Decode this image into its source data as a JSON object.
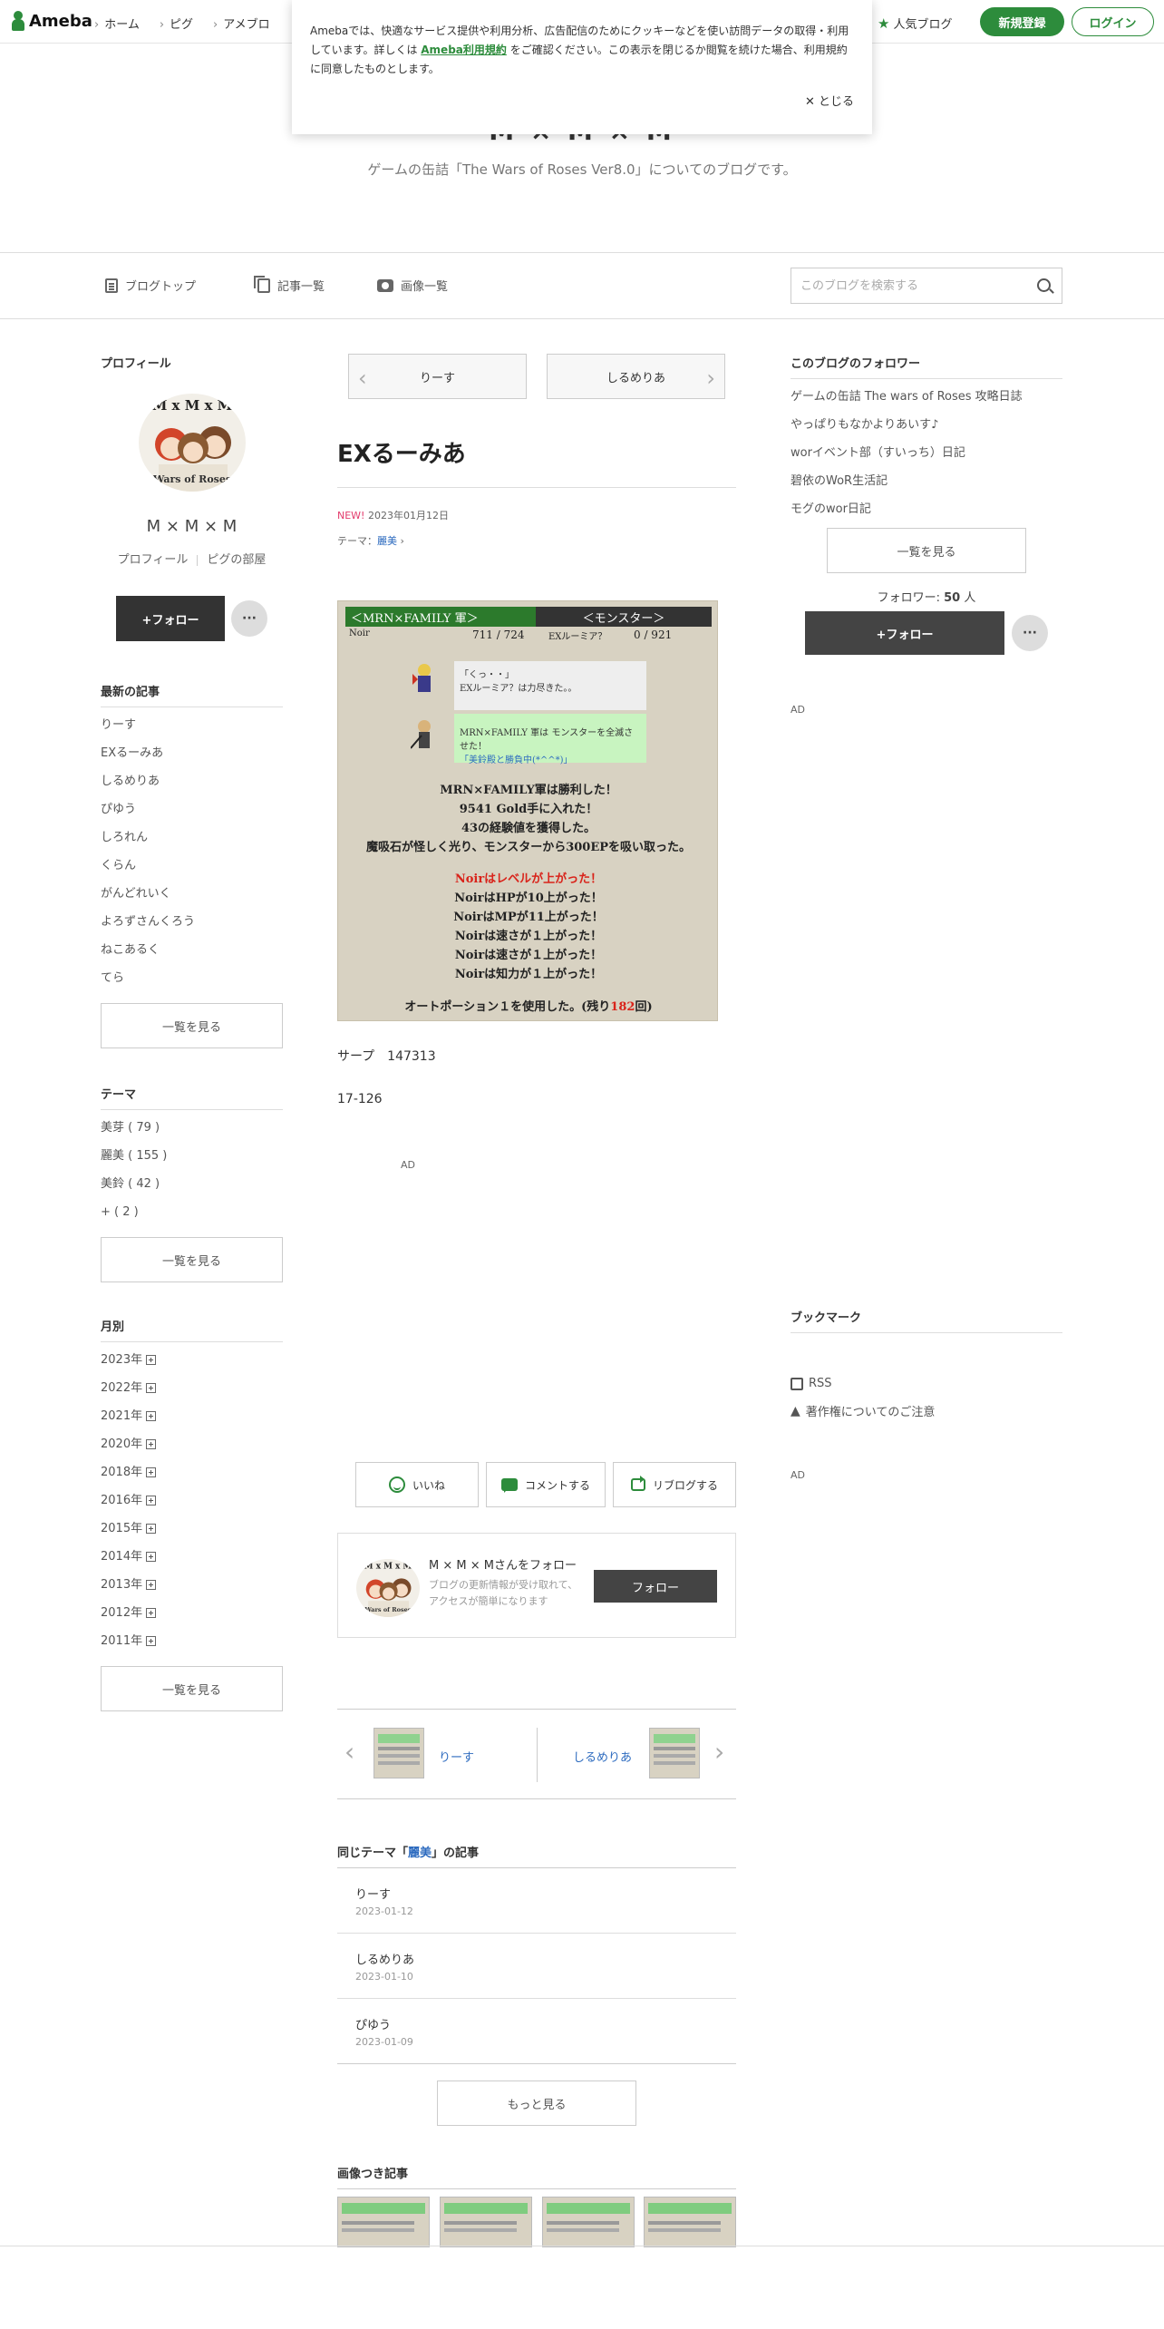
{
  "header": {
    "logo": "Ameba",
    "nav": [
      "ホーム",
      "ピグ",
      "アメブロ"
    ],
    "popular": "人気ブログ",
    "register": "新規登録",
    "login": "ログイン"
  },
  "cookie": {
    "text1": "Amebaでは、快適なサービス提供や利用分析、広告配信のためにクッキーなどを使い訪問データの取得・利用しています。詳しくは ",
    "link": "Ameba利用規約",
    "text2": " をご確認ください。この表示を閉じるか閲覧を続けた場合、利用規約に同意したものとします。",
    "close": "✕ とじる"
  },
  "blog": {
    "title": "M × M × M",
    "description": "ゲームの缶詰「The Wars of Roses Ver8.0」についてのブログです。"
  },
  "blognav": {
    "top": "ブログトップ",
    "list": "記事一覧",
    "images": "画像一覧",
    "search_placeholder": "このブログを検索する"
  },
  "profile": {
    "heading": "プロフィール",
    "avatar_text": "M x M x M",
    "avatar_sub": "Wars of Roses",
    "name": "M × M × M",
    "link_profile": "プロフィール",
    "link_room": "ピグの部屋",
    "follow": "+フォロー",
    "more": "···"
  },
  "recent": {
    "heading": "最新の記事",
    "items": [
      "りーす",
      "EXるーみあ",
      "しるめりあ",
      "ぴゆう",
      "しろれん",
      "くらん",
      "がんどれいく",
      "よろずさんくろう",
      "ねこあるく",
      "てら"
    ],
    "more": "一覧を見る"
  },
  "themes": {
    "heading": "テーマ",
    "items": [
      "美芽 ( 79 )",
      "麗美 ( 155 )",
      "美鈴 ( 42 )",
      "+ ( 2 )"
    ],
    "more": "一覧を見る"
  },
  "monthly": {
    "heading": "月別",
    "items": [
      "2023年",
      "2022年",
      "2021年",
      "2020年",
      "2018年",
      "2016年",
      "2015年",
      "2014年",
      "2013年",
      "2012年",
      "2011年"
    ],
    "more": "一覧を見る"
  },
  "entry": {
    "prev": "りーす",
    "next": "しるめりあ",
    "title": "EXるーみあ",
    "new": "NEW!",
    "date": "2023年01月12日",
    "theme_label": "テーマ：",
    "theme": "麗美",
    "body1": "サープ　147313",
    "body2": "17-126",
    "ad": "AD"
  },
  "game": {
    "bar_left": "＜MRN×FAMILY 軍＞",
    "bar_right": "＜モンスター＞",
    "name_left": "Noir",
    "hp_left": "711 / 724",
    "name_right": "EXルーミア？",
    "hp_right": "0 / 921",
    "msg1a": "「くっ・・」",
    "msg1b": "EXルーミア？は力尽きた。。",
    "msg2a": "MRN×FAMILY 軍は モンスターを全滅させた！",
    "msg2b": "「美鈴殿と勝負中(*^^*)」",
    "win": "MRN×FAMILY軍は勝利した！",
    "gold": "9541 Gold手に入れた！",
    "exp": "43の経験値を獲得した。",
    "ep": "魔吸石が怪しく光り、モンスターから300EPを吸い取った。",
    "lv": "Noirはレベルが上がった！",
    "hp": "NoirはHPが10上がった！",
    "mp": "NoirはMPが11上がった！",
    "spd1": "Noirは速さが１上がった！",
    "spd2": "Noirは速さが１上がった！",
    "int": "Noirは知力が１上がった！",
    "potion_a": "オートポーション１を使用した。(残り",
    "potion_n": "182",
    "potion_b": "回)"
  },
  "actions": {
    "like": "いいね",
    "comment": "コメントする",
    "reblog": "リブログする"
  },
  "follow_card": {
    "name": "M × M × Mさんをフォロー",
    "desc": "ブログの更新情報が受け取れて、アクセスが簡単になります",
    "button": "フォロー"
  },
  "bottom_nav": {
    "prev": "りーす",
    "next": "しるめりあ"
  },
  "same_theme": {
    "heading_a": "同じテーマ「",
    "heading_theme": "麗美",
    "heading_b": "」の記事",
    "items": [
      {
        "title": "りーす",
        "date": "2023-01-12"
      },
      {
        "title": "しるめりあ",
        "date": "2023-01-10"
      },
      {
        "title": "ぴゆう",
        "date": "2023-01-09"
      }
    ],
    "more": "もっと見る"
  },
  "image_articles": {
    "heading": "画像つき記事"
  },
  "right": {
    "followers_heading": "このブログのフォロワー",
    "followers": [
      "ゲームの缶詰 The wars of Roses 攻略日誌",
      "やっぱりもなかよりあいす♪",
      "worイベント部（すいっち）日記",
      "碧依のWoR生活記",
      "モグのwor日記"
    ],
    "followers_more": "一覧を見る",
    "follower_label": "フォロワー: ",
    "follower_count": "50",
    "follower_unit": " 人",
    "follow": "+フォロー",
    "more": "···",
    "ad1": "AD",
    "bookmark": "ブックマーク",
    "rss": "RSS",
    "copyright": "著作権についてのご注意",
    "ad2": "AD"
  },
  "colors": {
    "brand": "#2d8c3c",
    "link": "#2d6bbf",
    "new": "#e33b6c"
  }
}
